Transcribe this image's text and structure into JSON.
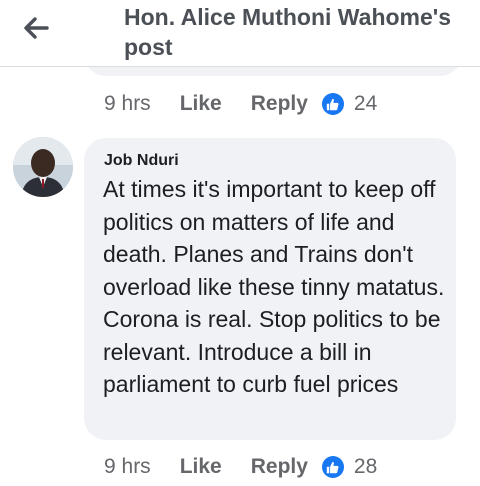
{
  "header": {
    "back_icon": "arrow-left-icon",
    "title": "Hon. Alice Muthoni Wahome's post"
  },
  "previous_comment": {
    "time": "9 hrs",
    "like_label": "Like",
    "reply_label": "Reply",
    "reaction_icon": "thumbs-up-icon",
    "like_count": "24"
  },
  "comment": {
    "author": "Job Nduri",
    "text": "At times it's important to keep off politics on matters of life and death. Planes and Trains don't overload like these tinny matatus. Corona is real. Stop politics to be relevant. Introduce a bill in parliament to curb fuel prices",
    "time": "9 hrs",
    "like_label": "Like",
    "reply_label": "Reply",
    "reaction_icon": "thumbs-up-icon",
    "like_count": "28"
  },
  "colors": {
    "like_blue": "#1877f2",
    "bubble_bg": "#f0f2f5",
    "meta_gray": "#65676b"
  }
}
